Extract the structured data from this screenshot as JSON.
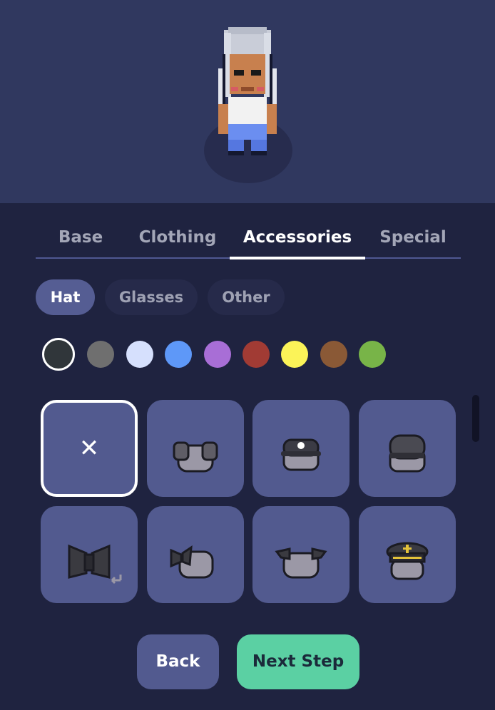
{
  "tabs": [
    {
      "label": "Base"
    },
    {
      "label": "Clothing"
    },
    {
      "label": "Accessories",
      "active": true
    },
    {
      "label": "Special"
    }
  ],
  "subtabs": [
    {
      "label": "Hat",
      "active": true
    },
    {
      "label": "Glasses"
    },
    {
      "label": "Other"
    }
  ],
  "colors": [
    "#30363a",
    "#6f6f6f",
    "#d6e0fd",
    "#5e98f8",
    "#a86ed6",
    "#a13b34",
    "#fbf358",
    "#8a5936",
    "#78b448"
  ],
  "selected_color_index": 0,
  "hat_items": [
    {
      "icon": "none-x-icon",
      "glyph": "✕",
      "selected": true
    },
    {
      "icon": "pigtail-buns-hat-icon"
    },
    {
      "icon": "cap-hat-icon"
    },
    {
      "icon": "beanie-hat-icon"
    },
    {
      "icon": "bow-tie-hat-icon"
    },
    {
      "icon": "side-bow-hat-icon"
    },
    {
      "icon": "horns-hat-icon"
    },
    {
      "icon": "captain-hat-icon"
    }
  ],
  "buttons": {
    "back": "Back",
    "next": "Next Step"
  }
}
